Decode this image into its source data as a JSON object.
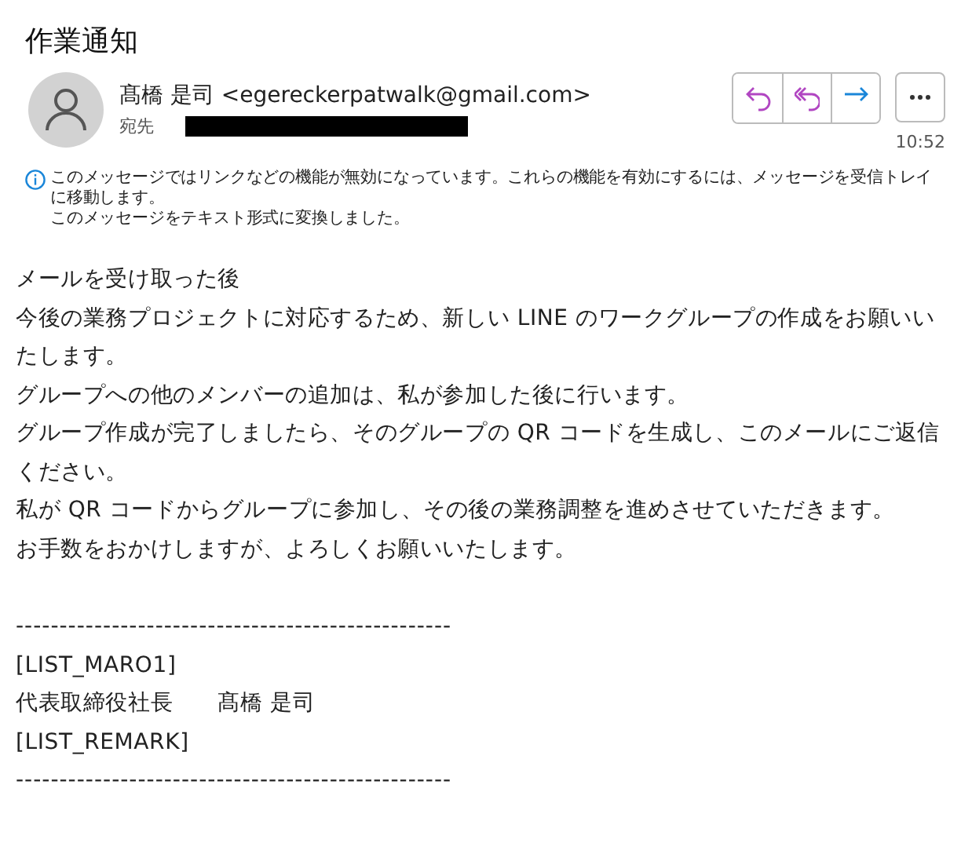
{
  "subject": "作業通知",
  "sender": {
    "name": "髙橋 是司",
    "address": "<egereckerpatwalk@gmail.com>"
  },
  "recipient": {
    "label": "宛先",
    "redacted": true
  },
  "actions": [
    {
      "kind": "reply"
    },
    {
      "kind": "reply-all"
    },
    {
      "kind": "forward"
    }
  ],
  "time": "10:52",
  "notices": [
    "このメッセージではリンクなどの機能が無効になっています。これらの機能を有効にするには、メッセージを受信トレイに移動します。",
    "このメッセージをテキスト形式に変換しました。"
  ],
  "body": [
    {
      "kind": "text",
      "text": "メールを受け取った後"
    },
    {
      "kind": "text",
      "text": "今後の業務プロジェクトに対応するため、新しい LINE のワークグループの作成をお願いいたします。"
    },
    {
      "kind": "text",
      "text": "グループへの他のメンバーの追加は、私が参加した後に行います。"
    },
    {
      "kind": "text",
      "text": "グループ作成が完了しましたら、そのグループの QR コードを生成し、このメールにご返信ください。"
    },
    {
      "kind": "text",
      "text": "私が QR コードからグループに参加し、その後の業務調整を進めさせていただきます。"
    },
    {
      "kind": "text",
      "text": "お手数をおかけしますが、よろしくお願いいたします。"
    },
    {
      "kind": "blank"
    },
    {
      "kind": "rule",
      "text": "--------------------------------------------------"
    },
    {
      "kind": "text",
      "text": "[LIST_MARO1]"
    },
    {
      "kind": "text",
      "text": "代表取締役社長　　髙橋  是司"
    },
    {
      "kind": "text",
      "text": "[LIST_REMARK]"
    },
    {
      "kind": "rule",
      "text": "--------------------------------------------------"
    }
  ]
}
